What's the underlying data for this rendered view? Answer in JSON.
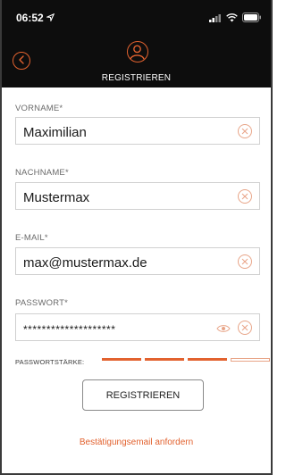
{
  "status_bar": {
    "time": "06:52"
  },
  "header": {
    "title": "REGISTRIEREN"
  },
  "form": {
    "firstname": {
      "label": "VORNAME*",
      "value": "Maximilian"
    },
    "lastname": {
      "label": "NACHNAME*",
      "value": "Mustermax"
    },
    "email": {
      "label": "E-MAIL*",
      "value": "max@mustermax.de"
    },
    "password": {
      "label": "PASSWORT*",
      "value": "********************"
    },
    "strength": {
      "label": "PASSWORTSTÄRKE:",
      "filled_segments": 3,
      "total_segments": 4
    }
  },
  "actions": {
    "submit_label": "REGISTRIEREN",
    "resend_label": "Bestätigungsemail anfordern"
  },
  "colors": {
    "accent": "#e2622f",
    "header_bg": "#0d0d0d"
  },
  "icons": [
    "location-arrow-icon",
    "signal-icon",
    "wifi-icon",
    "battery-icon",
    "back-icon",
    "user-icon",
    "clear-icon",
    "eye-icon"
  ]
}
